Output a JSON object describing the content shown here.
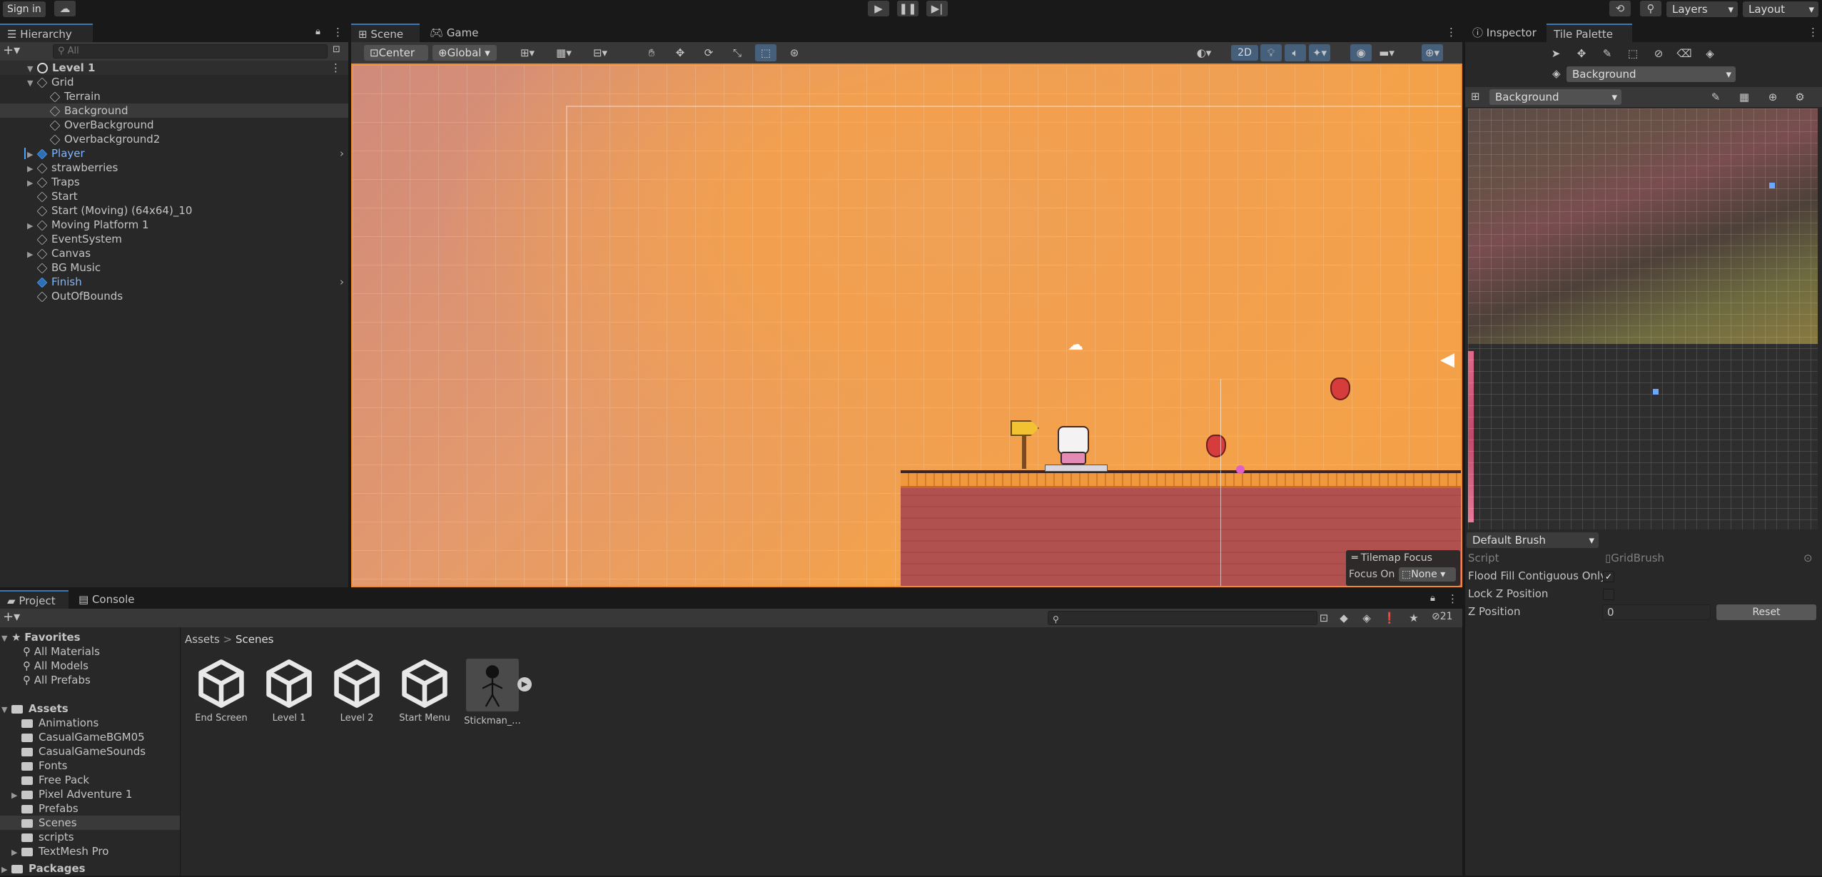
{
  "topbar": {
    "sign_in": "Sign in",
    "layers": "Layers",
    "layout": "Layout"
  },
  "hierarchy": {
    "tab": "Hierarchy",
    "search_placeholder": "All",
    "scene": "Level 1",
    "items": [
      {
        "label": "Grid",
        "depth": 1,
        "expanded": true,
        "type": "obj"
      },
      {
        "label": "Terrain",
        "depth": 2,
        "type": "obj"
      },
      {
        "label": "Background",
        "depth": 2,
        "type": "obj",
        "selected": true
      },
      {
        "label": "OverBackground",
        "depth": 2,
        "type": "obj"
      },
      {
        "label": "Overbackground2",
        "depth": 2,
        "type": "obj"
      },
      {
        "label": "Player",
        "depth": 1,
        "collapsed": true,
        "type": "prefab"
      },
      {
        "label": "strawberries",
        "depth": 1,
        "collapsed": true,
        "type": "obj"
      },
      {
        "label": "Traps",
        "depth": 1,
        "collapsed": true,
        "type": "obj"
      },
      {
        "label": "Start",
        "depth": 1,
        "type": "obj"
      },
      {
        "label": "Start (Moving) (64x64)_10",
        "depth": 1,
        "type": "obj"
      },
      {
        "label": "Moving Platform 1",
        "depth": 1,
        "collapsed": true,
        "type": "obj"
      },
      {
        "label": "EventSystem",
        "depth": 1,
        "type": "obj"
      },
      {
        "label": "Canvas",
        "depth": 1,
        "collapsed": true,
        "type": "obj"
      },
      {
        "label": "BG Music",
        "depth": 1,
        "type": "obj"
      },
      {
        "label": "Finish",
        "depth": 1,
        "type": "prefab"
      },
      {
        "label": "OutOfBounds",
        "depth": 1,
        "type": "obj"
      }
    ]
  },
  "scene_view": {
    "tabs": [
      "Scene",
      "Game"
    ],
    "pivot": "Center",
    "space": "Global",
    "mode_2d": "2D",
    "tilemap_focus_title": "Tilemap Focus",
    "focus_on_label": "Focus On",
    "focus_on_value": "None"
  },
  "inspector": {
    "tabs": [
      "Inspector",
      "Tile Palette"
    ],
    "active_tilemap": "Background",
    "palette": "Background",
    "brush": "Default Brush",
    "script_label": "Script",
    "script_value": "GridBrush",
    "flood_fill_label": "Flood Fill Contiguous Only",
    "flood_fill_checked": true,
    "lock_z_label": "Lock Z Position",
    "lock_z_checked": false,
    "z_position_label": "Z Position",
    "z_position_value": "0",
    "reset_label": "Reset"
  },
  "project": {
    "tabs": [
      "Project",
      "Console"
    ],
    "hidden_count": "21",
    "breadcrumb": [
      "Assets",
      "Scenes"
    ],
    "favorites_label": "Favorites",
    "favorites": [
      "All Materials",
      "All Models",
      "All Prefabs"
    ],
    "assets_label": "Assets",
    "asset_folders": [
      {
        "label": "Animations"
      },
      {
        "label": "CasualGameBGM05"
      },
      {
        "label": "CasualGameSounds"
      },
      {
        "label": "Fonts"
      },
      {
        "label": "Free Pack"
      },
      {
        "label": "Pixel Adventure 1",
        "collapsed": true
      },
      {
        "label": "Prefabs"
      },
      {
        "label": "Scenes",
        "selected": true
      },
      {
        "label": "scripts"
      },
      {
        "label": "TextMesh Pro",
        "collapsed": true
      }
    ],
    "packages_label": "Packages",
    "grid_items": [
      "End Screen",
      "Level 1",
      "Level 2",
      "Start Menu",
      "Stickman_..."
    ]
  },
  "colors": {
    "accent": "#3a79bb",
    "scene_sky_top": "#d9927d",
    "scene_sky_bottom": "#f7a94a",
    "ground": "#b0504f",
    "ground_top": "#e8903a"
  }
}
